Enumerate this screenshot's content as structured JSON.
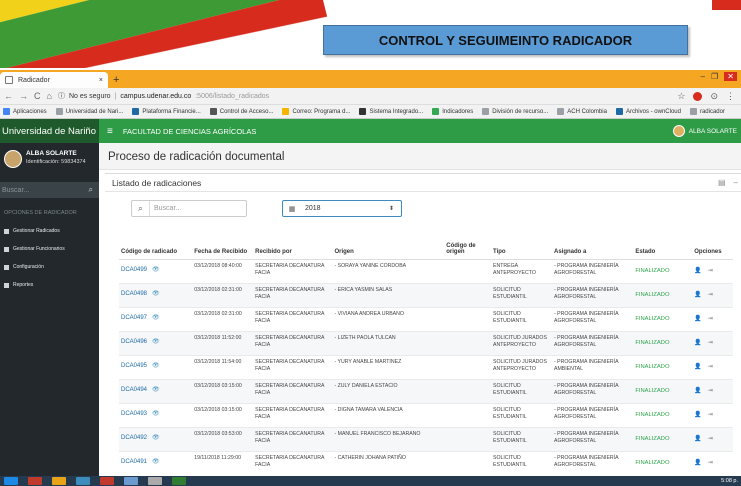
{
  "slide": {
    "title": "CONTROL Y SEGUIMEINTO RADICADOR"
  },
  "browser": {
    "tab_title": "Radicador",
    "tab_close": "×",
    "new_tab": "+",
    "security": "No es seguro",
    "url_host": "campus.udenar.edu.co",
    "url_path": ":5006/listado_radicados",
    "bookmarks": [
      "Aplicaciones",
      "Universidad de Nari...",
      "Plataforma Financie...",
      "Control de Acceso...",
      "Correo: Programa d...",
      "Sistema Integrado...",
      "Indicadores",
      "División de recurso...",
      "ACH Colombia",
      "Archivos - ownCloud",
      "radicador"
    ],
    "bookmark_colors": [
      "#4285f4",
      "#9aa0a6",
      "#1f69a4",
      "#555555",
      "#f4b400",
      "#333333",
      "#34a853",
      "#9aa0a6",
      "#9aa0a6",
      "#1f69a4",
      "#9aa0a6"
    ]
  },
  "app": {
    "brand": "Universidad de Nariño",
    "faculty": "FACULTAD DE CIENCIAS AGRÍCOLAS",
    "user_top": "ALBA SOLARTE"
  },
  "sidebar": {
    "user_name": "ALBA SOLARTE",
    "user_id": "Identificación: 59834374",
    "search_placeholder": "Buscar...",
    "section": "OPCIONES DE RADICADOR",
    "items": [
      "Gestionar Radicados",
      "Gestionar Funcionarios",
      "Configuración",
      "Reportes"
    ]
  },
  "main": {
    "page_title": "Proceso de radicación documental",
    "box_title": "Listado de radicaciones",
    "search_placeholder": "Buscar...",
    "year_value": "2018",
    "columns": [
      "Código de radicado",
      "Fecha de Recibido",
      "Recibido por",
      "Origen",
      "Código de origen",
      "Tipo",
      "Asignado a",
      "Estado",
      "Opciones"
    ],
    "rows": [
      {
        "code": "DCA0499",
        "date": "03/12/2018 08:40:00",
        "by": "SECRETARIA DECANATURA FACIA",
        "origin": "- SORAYA YANINE CORDOBA",
        "ocode": "",
        "type": "ENTREGA ANTEPROYECTO",
        "assigned": "- PROGRAMA INGENIERÍA AGROFORESTAL",
        "status": "FINALIZADO"
      },
      {
        "code": "DCA0498",
        "date": "03/12/2018 02:31:00",
        "by": "SECRETARIA DECANATURA FACIA",
        "origin": "- ERICA YASMIN SALAS",
        "ocode": "",
        "type": "SOLICITUD ESTUDIANTIL",
        "assigned": "- PROGRAMA INGENIERÍA AGROFORESTAL",
        "status": "FINALIZADO"
      },
      {
        "code": "DCA0497",
        "date": "03/12/2018 02:31:00",
        "by": "SECRETARIA DECANATURA FACIA",
        "origin": "- VIVIANA ANDREA URBANO",
        "ocode": "",
        "type": "SOLICITUD ESTUDIANTIL",
        "assigned": "- PROGRAMA INGENIERÍA AGROFORESTAL",
        "status": "FINALIZADO"
      },
      {
        "code": "DCA0496",
        "date": "03/12/2018 11:52:00",
        "by": "SECRETARIA DECANATURA FACIA",
        "origin": "- LIZETH PAOLA TULCAN",
        "ocode": "",
        "type": "SOLICITUD JURADOS ANTEPROYECTO",
        "assigned": "- PROGRAMA INGENIERÍA AGROFORESTAL",
        "status": "FINALIZADO"
      },
      {
        "code": "DCA0495",
        "date": "03/12/2018 11:54:00",
        "by": "SECRETARIA DECANATURA FACIA",
        "origin": "- YURY ANABLE MARTINEZ",
        "ocode": "",
        "type": "SOLICITUD JURADOS ANTEPROYECTO",
        "assigned": "- PROGRAMA INGENIERÍA AMBIENTAL",
        "status": "FINALIZADO"
      },
      {
        "code": "DCA0494",
        "date": "03/12/2018 03:15:00",
        "by": "SECRETARIA DECANATURA FACIA",
        "origin": "- ZULY DANIELA ESTACIO",
        "ocode": "",
        "type": "SOLICITUD ESTUDIANTIL",
        "assigned": "- PROGRAMA INGENIERÍA AGROFORESTAL",
        "status": "FINALIZADO"
      },
      {
        "code": "DCA0493",
        "date": "03/12/2018 03:15:00",
        "by": "SECRETARIA DECANATURA FACIA",
        "origin": "- DIGNA TAMARA VALENCIA",
        "ocode": "",
        "type": "SOLICITUD ESTUDIANTIL",
        "assigned": "- PROGRAMA INGENIERÍA AGROFORESTAL",
        "status": "FINALIZADO"
      },
      {
        "code": "DCA0492",
        "date": "03/12/2018 03:53:00",
        "by": "SECRETARIA DECANATURA FACIA",
        "origin": "- MANUEL FRANCISCO BEJARANO",
        "ocode": "",
        "type": "SOLICITUD ESTUDIANTIL",
        "assigned": "- PROGRAMA INGENIERÍA AGROFORESTAL",
        "status": "FINALIZADO"
      },
      {
        "code": "DCA0491",
        "date": "19/11/2018 11:29:00",
        "by": "SECRETARIA DECANATURA FACIA",
        "origin": "- CATHERIN JOHANA PATIÑO",
        "ocode": "",
        "type": "SOLICITUD ESTUDIANTIL",
        "assigned": "- PROGRAMA INGENIERÍA AGROFORESTAL",
        "status": "FINALIZADO"
      }
    ]
  },
  "taskbar": {
    "clock": "5:08 p."
  }
}
